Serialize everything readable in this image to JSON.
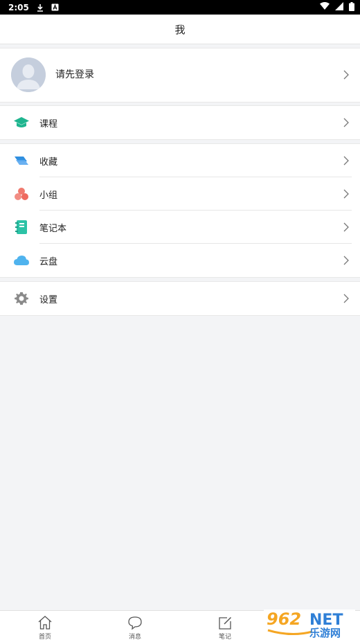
{
  "status_bar": {
    "time": "2:05"
  },
  "header": {
    "title": "我"
  },
  "profile": {
    "login_prompt": "请先登录"
  },
  "menu": {
    "course": {
      "label": "课程",
      "icon": "graduation-cap-icon",
      "color": "#1fb58f"
    },
    "favorites": {
      "label": "收藏",
      "icon": "bookmark-stack-icon",
      "color": "#2f8fe0"
    },
    "group": {
      "label": "小组",
      "icon": "group-circles-icon",
      "color": "#f07a6f"
    },
    "notebook": {
      "label": "笔记本",
      "icon": "notebook-icon",
      "color": "#2cc2a6"
    },
    "cloud": {
      "label": "云盘",
      "icon": "cloud-icon",
      "color": "#4fb3ee"
    },
    "settings": {
      "label": "设置",
      "icon": "gear-icon",
      "color": "#8a8a8a"
    }
  },
  "bottom_nav": {
    "tabs": [
      {
        "label": "首页",
        "icon": "home-icon"
      },
      {
        "label": "消息",
        "icon": "message-icon"
      },
      {
        "label": "笔记",
        "icon": "edit-note-icon"
      }
    ]
  },
  "watermark": {
    "text": "962NET",
    "subtext": "乐游网"
  }
}
